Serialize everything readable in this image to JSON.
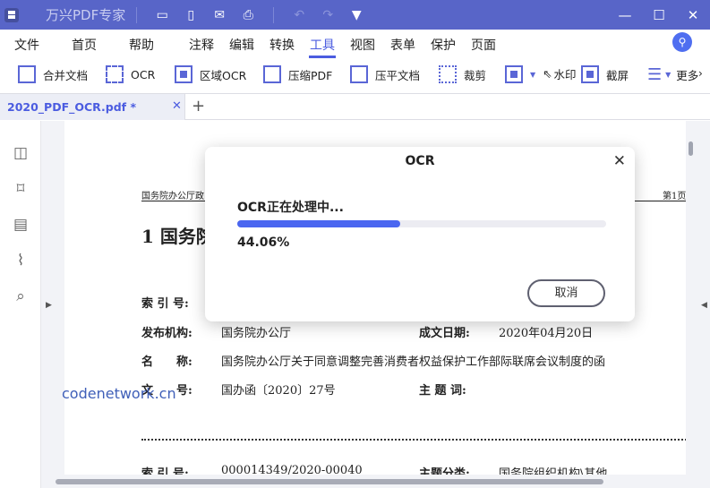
{
  "app": {
    "title": "万兴PDF专家",
    "accent": "#5865c8"
  },
  "menu": [
    "文件",
    "首页",
    "帮助",
    "注释",
    "编辑",
    "转换",
    "工具",
    "视图",
    "表单",
    "保护",
    "页面"
  ],
  "menu_active": "工具",
  "toolbar": [
    "合并文档",
    "OCR",
    "区域OCR",
    "压缩PDF",
    "压平文档",
    "裁剪",
    "",
    "水印",
    "截屏",
    "更多"
  ],
  "tab": {
    "label": "2020_PDF_OCR.pdf *"
  },
  "doc": {
    "header_left": "国务院办公厅政",
    "header_right": "第1页",
    "heading": "1  国务院",
    "rows": [
      {
        "k": "索 引 号:",
        "v": ""
      },
      {
        "k": "发布机构:",
        "v": "国务院办公厅",
        "k2": "成文日期:",
        "v2": "2020年04月20日"
      },
      {
        "k": "名　　称:",
        "v": "国务院办公厅关于同意调整完善消费者权益保护工作部际联席会议制度的函"
      },
      {
        "k": "文　　号:",
        "v": "国办函〔2020〕27号",
        "k2": "主 题 词:",
        "v2": ""
      },
      {
        "k": "索 引 号:",
        "v": "000014349/2020-00040",
        "k2": "主题分类:",
        "v2": "国务院组织机构\\其他"
      }
    ]
  },
  "dialog": {
    "title": "OCR",
    "status": "OCR正在处理中...",
    "progress_percent": 44.06,
    "progress_label": "44.06%",
    "cancel": "取消"
  },
  "watermark": "codenetwork.cn"
}
